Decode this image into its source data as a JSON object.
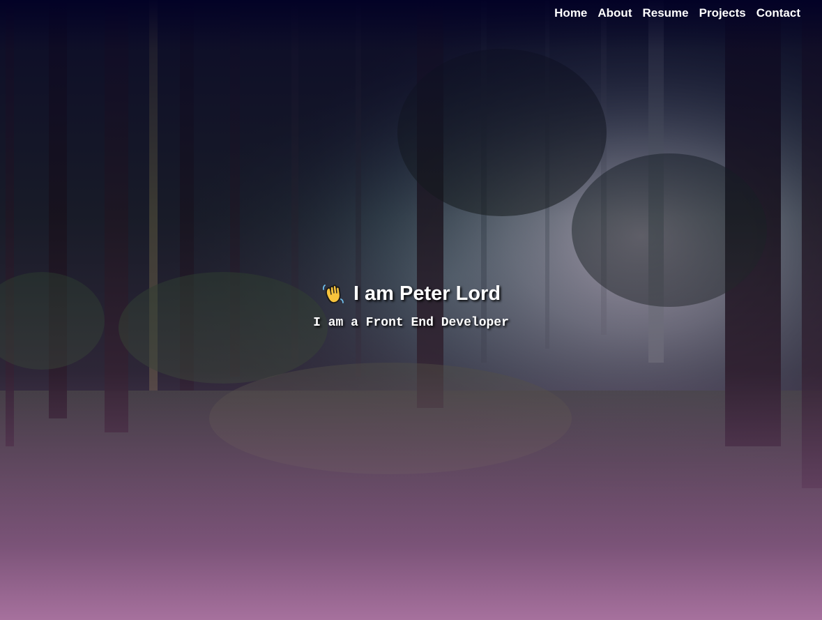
{
  "nav": {
    "items": [
      {
        "label": "Home"
      },
      {
        "label": "About"
      },
      {
        "label": "Resume"
      },
      {
        "label": "Projects"
      },
      {
        "label": "Contact"
      }
    ]
  },
  "hero": {
    "wave_icon": "waving-hand-icon",
    "title": "I am Peter Lord",
    "subtitle": "I am a Front End Developer",
    "background": "misty-forest-photo"
  },
  "colors": {
    "top_overlay": "#020126",
    "bottom_overlay": "#af76a5",
    "text": "#ffffff"
  }
}
